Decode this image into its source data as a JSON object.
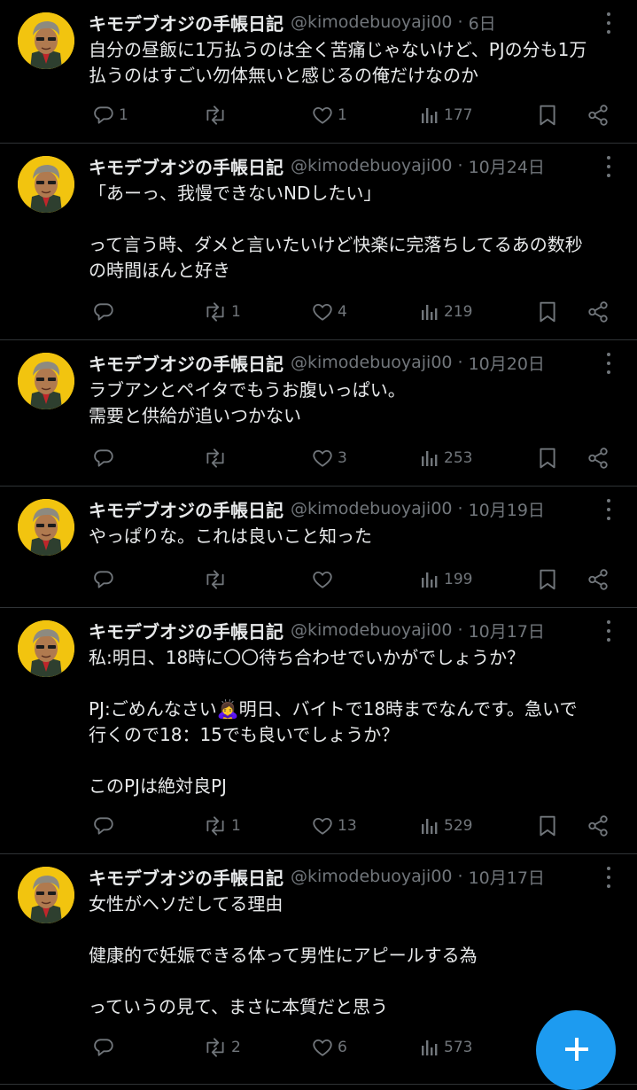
{
  "account": {
    "name": "キモデブオジの手帳日記",
    "handle": "@kimodebuoyaji00",
    "separator": "·"
  },
  "tweets": [
    {
      "date": "6日",
      "lines": [
        "自分の昼飯に1万払うのは全く苦痛じゃないけど、PJの分も1万",
        "払うのはすごい勿体無いと感じるの俺だけなのか"
      ],
      "replies": "1",
      "retweets": "",
      "likes": "1",
      "views": "177"
    },
    {
      "date": "10月24日",
      "lines": [
        "「あーっ、我慢できないNDしたい」",
        "",
        "って言う時、ダメと言いたいけど快楽に完落ちしてるあの数秒",
        "の時間ほんと好き"
      ],
      "replies": "",
      "retweets": "1",
      "likes": "4",
      "views": "219"
    },
    {
      "date": "10月20日",
      "lines": [
        "ラブアンとペイタでもうお腹いっぱい。",
        "需要と供給が追いつかない"
      ],
      "replies": "",
      "retweets": "",
      "likes": "3",
      "views": "253"
    },
    {
      "date": "10月19日",
      "lines": [
        "やっぱりな。これは良いこと知った"
      ],
      "replies": "",
      "retweets": "",
      "likes": "",
      "views": "199"
    },
    {
      "date": "10月17日",
      "lines": [
        "私:明日、18時に〇〇待ち合わせでいかがでしょうか？",
        "",
        "PJ:ごめんなさい🙇‍♀️明日、バイトで18時までなんです。急いで",
        "行くので18：15でも良いでしょうか？",
        "",
        "このPJは絶対良PJ"
      ],
      "replies": "",
      "retweets": "1",
      "likes": "13",
      "views": "529"
    },
    {
      "date": "10月17日",
      "lines": [
        "女性がヘソだしてる理由",
        "",
        "健康的で妊娠できる体って男性にアピールする為",
        "",
        "っていうの見て、まさに本質だと思う"
      ],
      "replies": "",
      "retweets": "2",
      "likes": "6",
      "views": "573"
    }
  ],
  "icons": {
    "reply": "reply-icon",
    "retweet": "retweet-icon",
    "like": "heart-icon",
    "views": "views-icon",
    "bookmark": "bookmark-icon",
    "share": "share-icon",
    "more": "more-icon",
    "compose": "plus-icon"
  },
  "colors": {
    "background": "#000000",
    "text": "#e7e9ea",
    "muted": "#71767b",
    "accent": "#1d9bf0",
    "avatar": "#f2c40f"
  }
}
